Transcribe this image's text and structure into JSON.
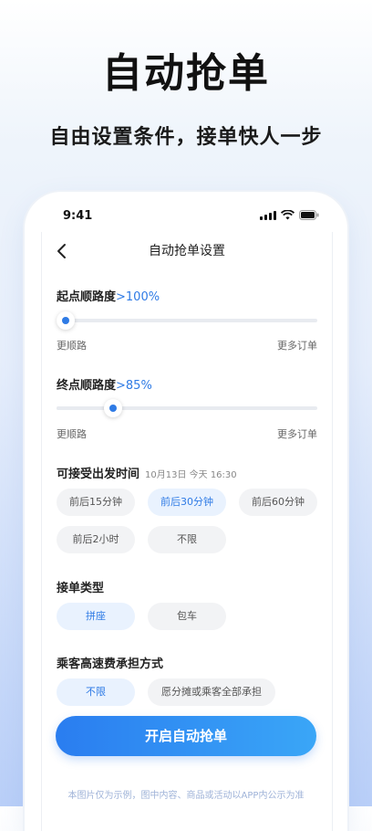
{
  "banner": {
    "headline": "自动抢单",
    "subline": "自由设置条件，接单快人一步"
  },
  "status": {
    "time": "9:41"
  },
  "nav": {
    "title": "自动抢单设置"
  },
  "start_route": {
    "label": "起点顺路度",
    "value": ">100%",
    "level_pct": 0,
    "left_text": "更顺路",
    "right_text": "更多订单"
  },
  "end_route": {
    "label": "终点顺路度",
    "value": ">85%",
    "level_pct": 21.7,
    "left_text": "更顺路",
    "right_text": "更多订单"
  },
  "departure": {
    "label": "可接受出发时间",
    "hint": "10月13日 今天 16:30",
    "options": [
      "前后15分钟",
      "前后30分钟",
      "前后60分钟",
      "前后2小时",
      "不限"
    ],
    "selected": "前后30分钟"
  },
  "order_type": {
    "label": "接单类型",
    "options": [
      "拼座",
      "包车"
    ],
    "selected": "拼座"
  },
  "toll": {
    "label": "乘客高速费承担方式",
    "options": [
      "不限",
      "愿分摊或乘客全部承担"
    ],
    "selected": "不限"
  },
  "cta": {
    "label": "开启自动抢单"
  },
  "footnote": "本图片仅为示例，图中内容、商品或活动以APP内公示为准",
  "colors": {
    "accent": "#2f7be5",
    "selected_chip_bg": "#e9f2fe",
    "cta_start": "#2a7df0",
    "cta_end": "#3aa6f7"
  }
}
